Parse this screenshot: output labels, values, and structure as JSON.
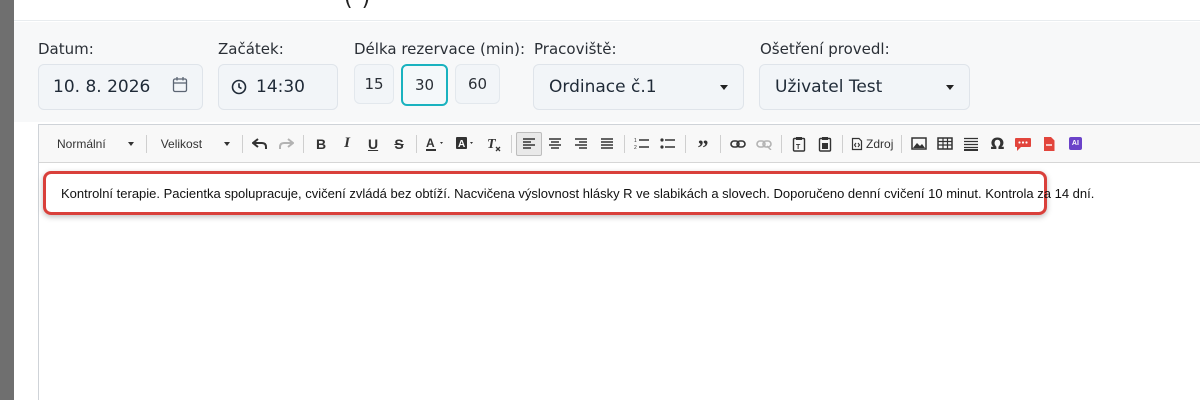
{
  "form": {
    "date": {
      "label": "Datum:",
      "value": "10. 8. 2026",
      "icon": "calendar-icon"
    },
    "start": {
      "label": "Začátek:",
      "value": "14:30",
      "icon": "clock-icon"
    },
    "duration": {
      "label": "Délka rezervace (min):",
      "options": [
        "15",
        "30",
        "60"
      ],
      "selected": "30"
    },
    "workplace": {
      "label": "Pracoviště:",
      "value": "Ordinace č.1"
    },
    "treated_by": {
      "label": "Ošetření provedl:",
      "value": "Uživatel Test"
    }
  },
  "toolbar": {
    "format": "Normální",
    "size": "Velikost",
    "source_label": "Zdroj",
    "ai_label": "AI"
  },
  "editor": {
    "text": "Kontrolní terapie. Pacientka spolupracuje, cvičení zvládá bez obtíží. Nacvičena výslovnost hlásky R ve slabikách a slovech. Doporučeno denní cvičení 10 minut. Kontrola za 14 dní."
  },
  "colors": {
    "accent": "#19b2bf",
    "highlight_border": "#d9403b"
  }
}
